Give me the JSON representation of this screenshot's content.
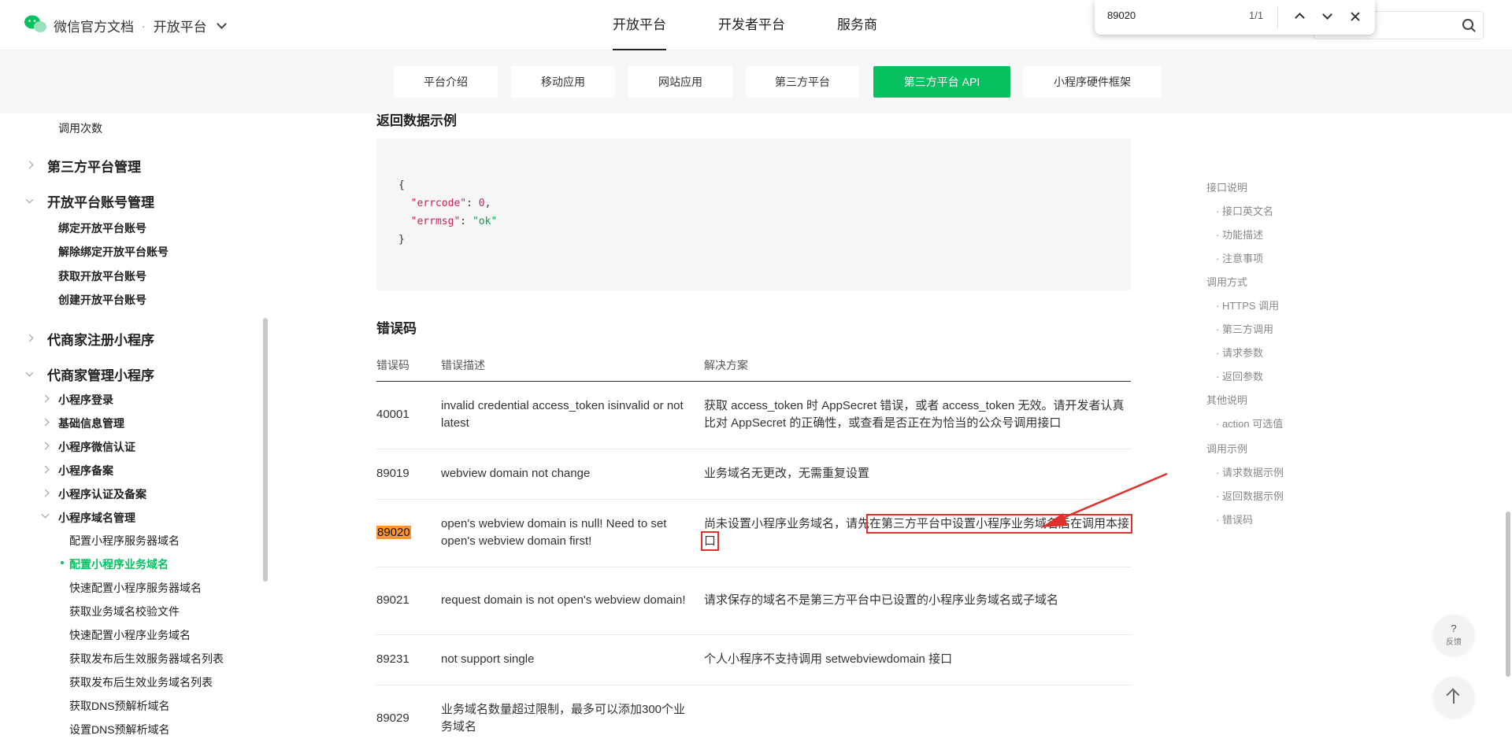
{
  "header": {
    "brand": "微信官方文档",
    "separator": "·",
    "platform_switch": "开放平台",
    "nav": [
      "开放平台",
      "开发者平台",
      "服务商"
    ]
  },
  "find_bar": {
    "query": "89020",
    "count": "1/1"
  },
  "sub_nav": [
    "平台介绍",
    "移动应用",
    "网站应用",
    "第三方平台",
    "第三方平台 API",
    "小程序硬件框架"
  ],
  "sidebar": {
    "top_item": "调用次数",
    "groups": [
      {
        "label": "第三方平台管理"
      },
      {
        "label": "开放平台账号管理",
        "items": [
          "绑定开放平台账号",
          "解除绑定开放平台账号",
          "获取开放平台账号",
          "创建开放平台账号"
        ]
      },
      {
        "label": "代商家注册小程序"
      },
      {
        "label": "代商家管理小程序",
        "items": [
          "小程序登录",
          "基础信息管理",
          "小程序微信认证",
          "小程序备案",
          "小程序认证及备案",
          "小程序域名管理"
        ],
        "domain_items": [
          "配置小程序服务器域名",
          "配置小程序业务域名",
          "快速配置小程序服务器域名",
          "获取业务域名校验文件",
          "快速配置小程序业务域名",
          "获取发布后生效服务器域名列表",
          "获取发布后生效业务域名列表",
          "获取DNS预解析域名",
          "设置DNS预解析域名"
        ]
      }
    ]
  },
  "content": {
    "return_example_title": "返回数据示例",
    "code": {
      "open": "{",
      "errcode_key": "\"errcode\"",
      "errcode_val": "0",
      "errmsg_key": "\"errmsg\"",
      "errmsg_val": "\"ok\"",
      "close": "}"
    },
    "error_title": "错误码",
    "table": {
      "headers": [
        "错误码",
        "错误描述",
        "解决方案"
      ],
      "rows": [
        {
          "code": "40001",
          "desc": "invalid credential  access_token isinvalid or not latest",
          "solution": "获取 access_token 时 AppSecret 错误，或者 access_token 无效。请开发者认真比对 AppSecret 的正确性，或查看是否正在为恰当的公众号调用接口"
        },
        {
          "code": "89019",
          "desc": "webview domain not change",
          "solution": "业务域名无更改，无需重复设置"
        },
        {
          "code": "89020",
          "desc": "open's webview domain is null! Need to set open's webview domain first!",
          "solution_a": "尚未设置小程序业务域名，请先",
          "solution_b": "在第三方平台中设置小程序业务域名后在调用本接口"
        },
        {
          "code": "89021",
          "desc": "request domain is not open's webview domain!",
          "solution": "请求保存的域名不是第三方平台中已设置的小程序业务域名或子域名"
        },
        {
          "code": "89231",
          "desc": "not support single",
          "solution": "个人小程序不支持调用 setwebviewdomain 接口"
        },
        {
          "code": "89029",
          "desc": "业务域名数量超过限制，最多可以添加300个业务域名",
          "solution": ""
        }
      ]
    }
  },
  "toc": [
    {
      "label": "接口说明",
      "level": 1
    },
    {
      "label": "· 接口英文名",
      "level": 2
    },
    {
      "label": "· 功能描述",
      "level": 2
    },
    {
      "label": "· 注意事项",
      "level": 2
    },
    {
      "label": "调用方式",
      "level": 1
    },
    {
      "label": "· HTTPS 调用",
      "level": 2
    },
    {
      "label": "· 第三方调用",
      "level": 2
    },
    {
      "label": "· 请求参数",
      "level": 2
    },
    {
      "label": "· 返回参数",
      "level": 2
    },
    {
      "label": "其他说明",
      "level": 1
    },
    {
      "label": "· action 可选值",
      "level": 2
    },
    {
      "label": "调用示例",
      "level": 1
    },
    {
      "label": "· 请求数据示例",
      "level": 2
    },
    {
      "label": "· 返回数据示例",
      "level": 2
    },
    {
      "label": "· 错误码",
      "level": 2
    }
  ],
  "feedback": {
    "symbol": "?",
    "label": "反馈"
  },
  "colors": {
    "accent": "#07c160",
    "highlight": "#ff9632",
    "annotation": "#e0302a"
  }
}
